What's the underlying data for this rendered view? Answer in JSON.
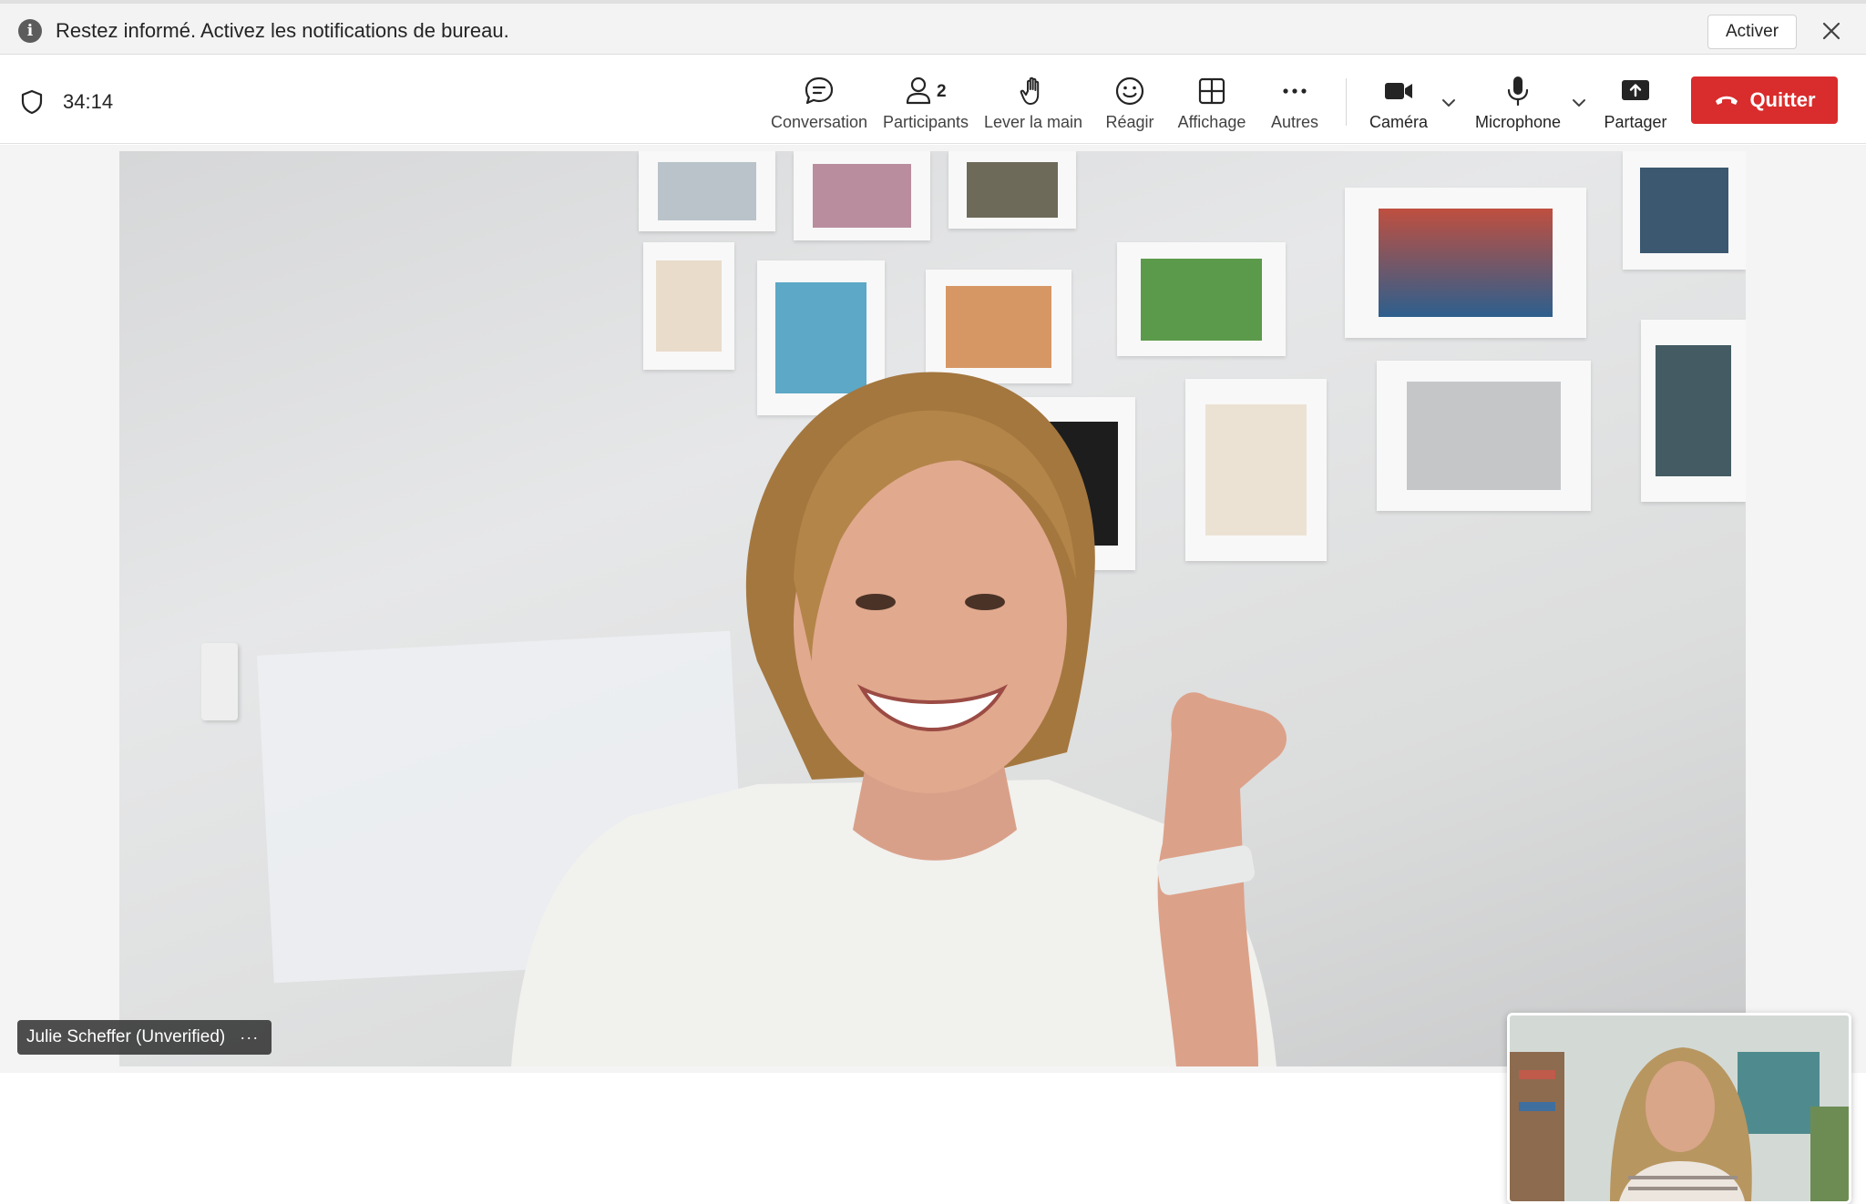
{
  "banner": {
    "message": "Restez informé. Activez les notifications de bureau.",
    "activate_label": "Activer",
    "info_icon": "info-icon",
    "close_icon": "close-icon"
  },
  "meeting": {
    "timer": "34:14",
    "security_icon": "shield-icon"
  },
  "toolbar": {
    "chat_label": "Conversation",
    "participants_label": "Participants",
    "participants_count": "2",
    "raise_hand_label": "Lever la main",
    "react_label": "Réagir",
    "view_label": "Affichage",
    "more_label": "Autres",
    "camera_label": "Caméra",
    "microphone_label": "Microphone",
    "share_label": "Partager",
    "leave_label": "Quitter",
    "leave_color": "#d92c2c"
  },
  "video": {
    "main_participant_name": "Julie Scheffer (Unverified)",
    "more_options": "···"
  }
}
